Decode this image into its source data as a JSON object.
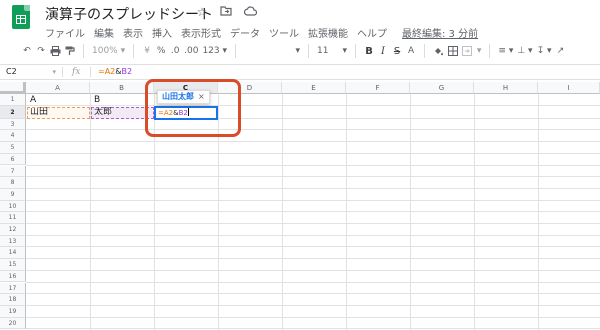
{
  "title_bar": {
    "doc_title": "演算子のスプレッドシート",
    "icons": [
      "star-icon",
      "folder-move-icon",
      "cloud-icon"
    ]
  },
  "menu": {
    "items": [
      "ファイル",
      "編集",
      "表示",
      "挿入",
      "表示形式",
      "データ",
      "ツール",
      "拡張機能",
      "ヘルプ"
    ],
    "last_edit": "最終編集: 3 分前"
  },
  "toolbar": {
    "zoom": "100%",
    "percent": "%",
    "decimal_decrease": ".0",
    "decimal_increase": ".00",
    "number_format": "123",
    "font_size": "11",
    "bold": "B",
    "italic": "I",
    "strike": "S",
    "text_color": "A"
  },
  "formula_bar": {
    "cell_ref": "C2",
    "fx": "fx",
    "formula_a2": "=A2",
    "formula_op": "&",
    "formula_b2": "B2"
  },
  "sheet": {
    "columns": [
      "A",
      "B",
      "C",
      "D",
      "E",
      "F",
      "G",
      "H",
      "I"
    ],
    "rows": [
      "1",
      "2",
      "3",
      "4",
      "5",
      "6",
      "7",
      "8",
      "9",
      "10",
      "11",
      "12",
      "13",
      "14",
      "15",
      "16",
      "17",
      "18",
      "19",
      "20"
    ],
    "selected_column": "C",
    "selected_row": "2",
    "cells": {
      "A1": "A",
      "B1": "B",
      "A2": "山田",
      "B2": "太郎",
      "C2_a2": "=A2",
      "C2_op": "&",
      "C2_b2": "B2"
    },
    "tooltip": {
      "value": "山田太郎",
      "close": "×"
    }
  },
  "colors": {
    "ref_a2": "#e37400",
    "ref_b2": "#9334e6",
    "selection": "#1a73e8",
    "highlight": "#d84c2a",
    "sheets_green": "#0f9d58"
  }
}
